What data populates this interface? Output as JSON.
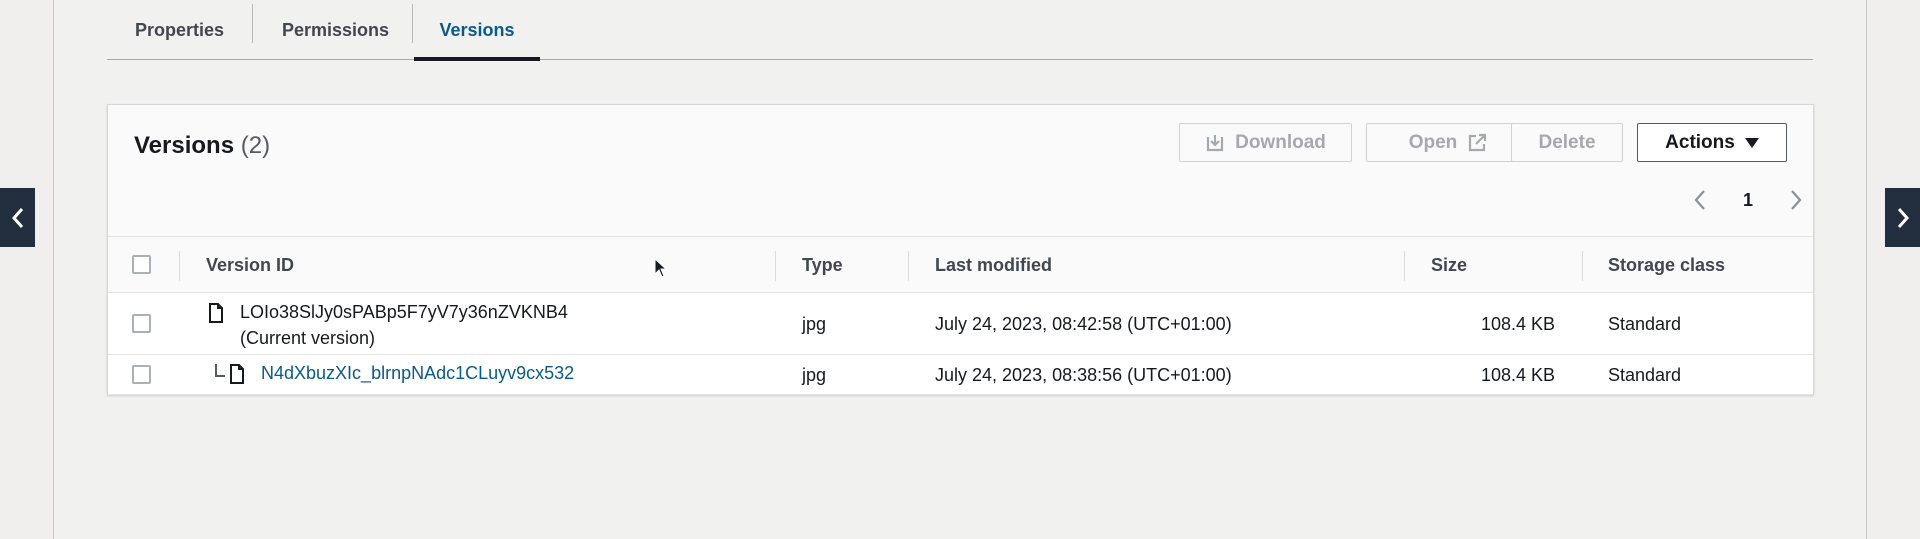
{
  "tabs": [
    {
      "label": "Properties"
    },
    {
      "label": "Permissions"
    },
    {
      "label": "Versions",
      "active": true
    }
  ],
  "versions_panel": {
    "title": "Versions",
    "count": "(2)",
    "buttons": {
      "download": "Download",
      "open": "Open",
      "delete": "Delete",
      "actions": "Actions"
    },
    "pagination": {
      "current_page": "1"
    },
    "columns": [
      "Version ID",
      "Type",
      "Last modified",
      "Size",
      "Storage class"
    ],
    "rows": [
      {
        "version_id": "LOIo38SlJy0sPABp5F7yV7y36nZVKNB4",
        "note": "(Current version)",
        "type": "jpg",
        "last_modified": "July 24, 2023, 08:42:58 (UTC+01:00)",
        "size": "108.4 KB",
        "storage_class": "Standard"
      },
      {
        "version_id": "N4dXbuzXIc_blrnpNAdc1CLuyv9cx532",
        "type": "jpg",
        "last_modified": "July 24, 2023, 08:38:56 (UTC+01:00)",
        "size": "108.4 KB",
        "storage_class": "Standard"
      }
    ]
  },
  "colors": {
    "link": "#0a5a8a",
    "nav_button": "#232f3e",
    "disabled_text": "#a4a9ae"
  }
}
